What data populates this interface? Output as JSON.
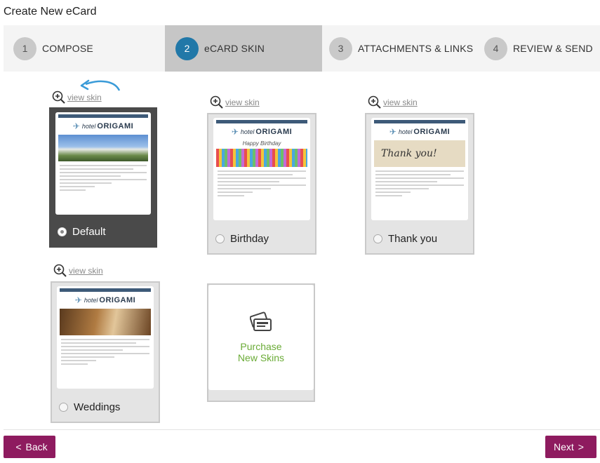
{
  "page": {
    "title": "Create New eCard"
  },
  "steps": [
    {
      "num": "1",
      "label": "COMPOSE",
      "active": false
    },
    {
      "num": "2",
      "label": "eCARD SKIN",
      "active": true
    },
    {
      "num": "3",
      "label": "ATTACHMENTS & LINKS",
      "active": false
    },
    {
      "num": "4",
      "label": "REVIEW & SEND",
      "active": false
    }
  ],
  "view_skin_label": "view skin",
  "skins": [
    {
      "name": "Default",
      "selected": true,
      "hero": "hotel"
    },
    {
      "name": "Birthday",
      "selected": false,
      "hero": "birthday"
    },
    {
      "name": "Thank you",
      "selected": false,
      "hero": "thankyou"
    },
    {
      "name": "Weddings",
      "selected": false,
      "hero": "weddings"
    }
  ],
  "thumbnail": {
    "hotel_word": "hotel",
    "brand": "ORIGAMI",
    "thankyou_text": "Thank you!"
  },
  "purchase": {
    "line1": "Purchase",
    "line2": "New Skins"
  },
  "footer": {
    "back_label": "Back",
    "next_label": "Next",
    "back_chevron": "<",
    "next_chevron": ">"
  },
  "colors": {
    "accent": "#8e1b5f",
    "step_active": "#2178a8",
    "purchase_text": "#6aab36",
    "selected_card": "#4a4a4a"
  }
}
